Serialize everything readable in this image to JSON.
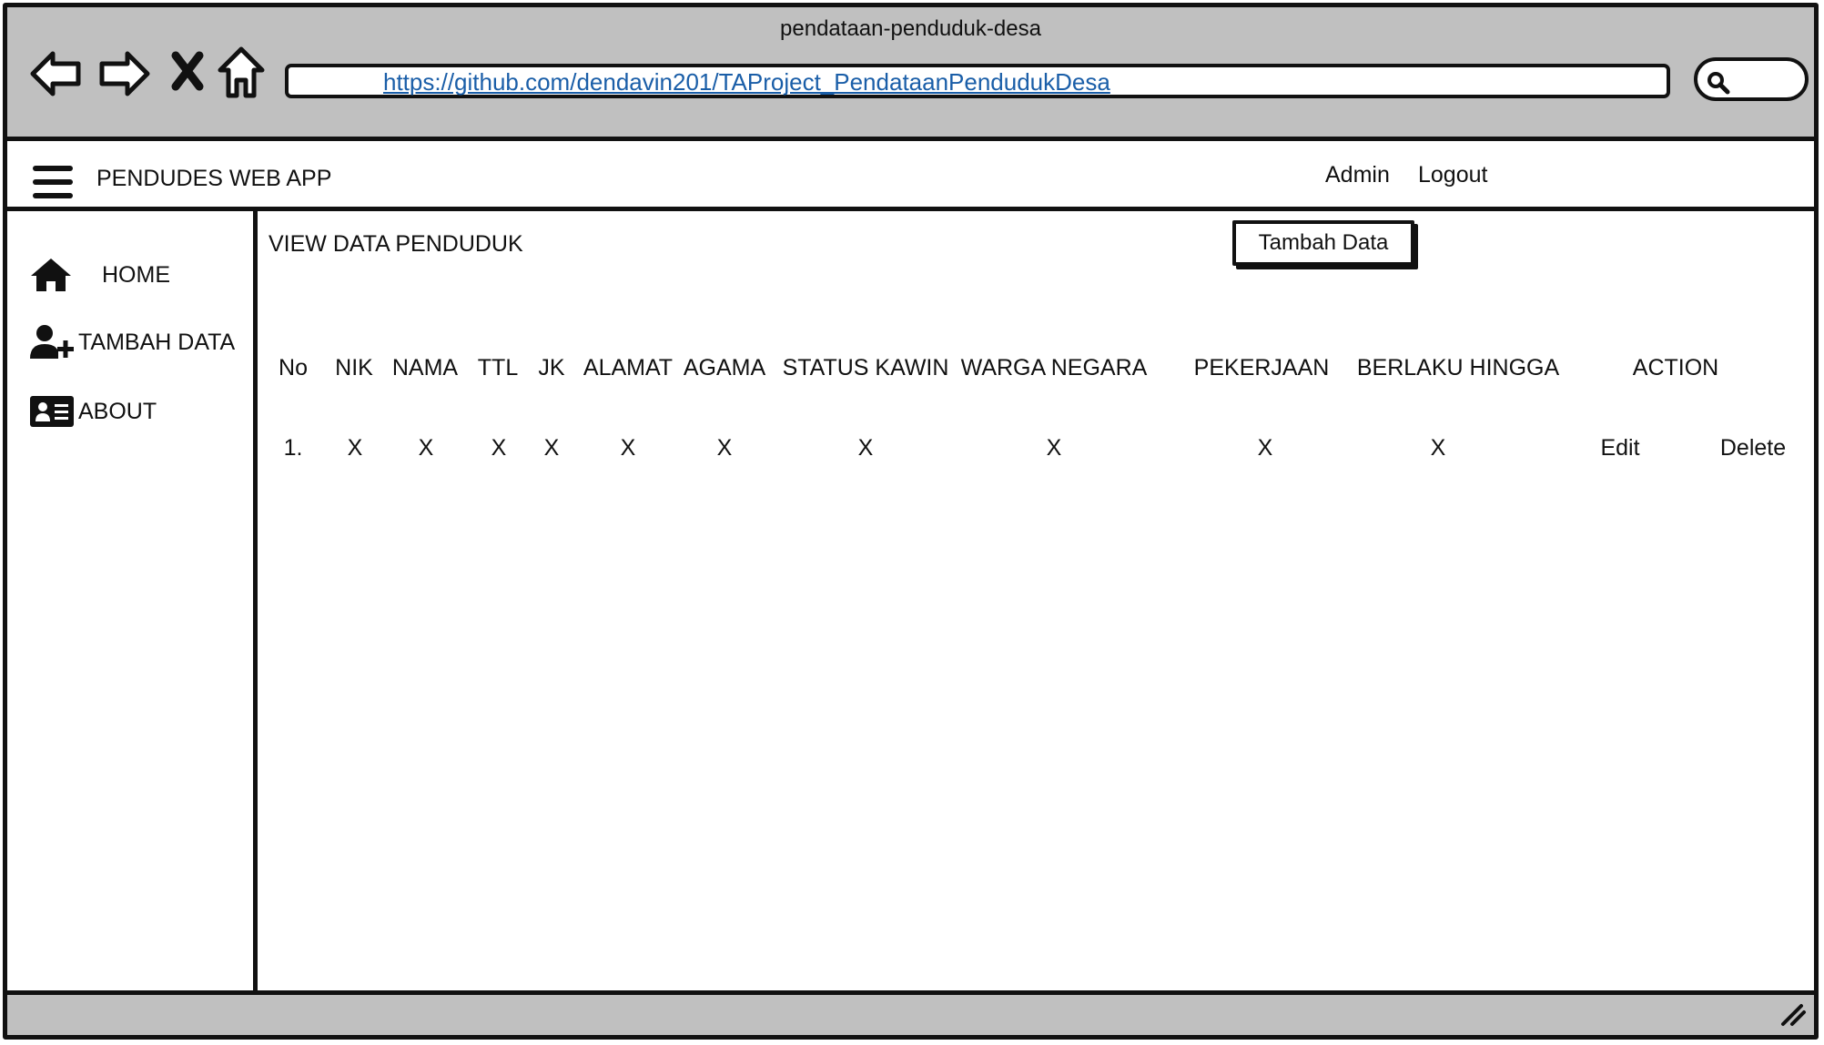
{
  "browser": {
    "window_title": "pendataan-penduduk-desa",
    "url": "https://github.com/dendavin201/TAProject_PendataanPendudukDesa",
    "nav_icons": [
      "back-arrow-icon",
      "forward-arrow-icon",
      "close-x-icon",
      "home-icon"
    ],
    "search_icon": "search-icon"
  },
  "header": {
    "app_title": "PENDUDES WEB APP",
    "menu_icon": "hamburger-menu-icon",
    "links": {
      "admin": "Admin",
      "logout": "Logout"
    }
  },
  "sidebar": {
    "items": [
      {
        "label": "HOME",
        "icon": "home-icon"
      },
      {
        "label": "TAMBAH DATA",
        "icon": "add-user-icon"
      },
      {
        "label": "ABOUT",
        "icon": "id-card-icon"
      }
    ]
  },
  "main": {
    "title": "VIEW DATA PENDUDUK",
    "add_button": "Tambah Data",
    "table": {
      "headers": [
        "No",
        "NIK",
        "NAMA",
        "TTL",
        "JK",
        "ALAMAT",
        "AGAMA",
        "STATUS KAWIN",
        "WARGA NEGARA",
        "PEKERJAAN",
        "BERLAKU HINGGA",
        "ACTION"
      ],
      "rows": [
        {
          "cells": [
            "1.",
            "X",
            "X",
            "X",
            "X",
            "X",
            "X",
            "X",
            "X",
            "X",
            "X"
          ],
          "actions": {
            "edit": "Edit",
            "delete": "Delete"
          }
        }
      ]
    }
  },
  "colors": {
    "chrome_gray": "#c0c0c0",
    "outline": "#111111",
    "link_blue": "#1a5ea8",
    "background": "#ffffff"
  }
}
